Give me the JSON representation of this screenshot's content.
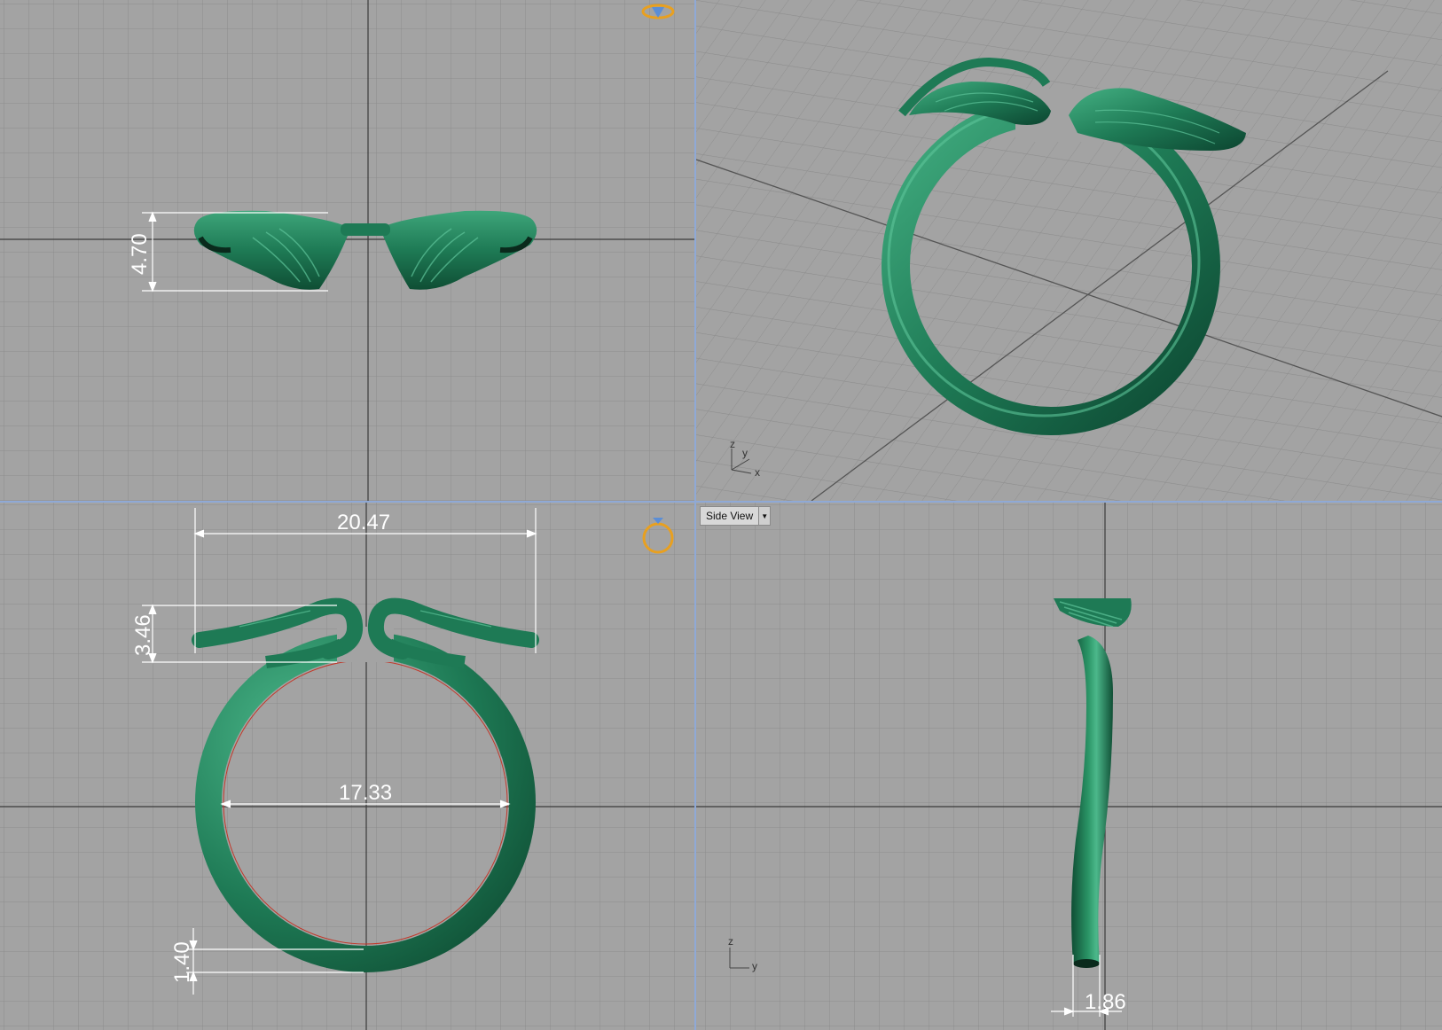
{
  "viewports": {
    "top": {
      "dimensions": {
        "height": "4.70"
      }
    },
    "perspective": {
      "axes": {
        "z": "z",
        "y": "y",
        "x": "x"
      }
    },
    "front": {
      "dimensions": {
        "width_total": "20.47",
        "wing_height": "3.46",
        "inner_diameter": "17.33",
        "band_thickness": "1.40"
      }
    },
    "side": {
      "label": "Side View",
      "dropdown_icon": "chevron-down-icon",
      "axes": {
        "z": "z",
        "y": "y"
      },
      "dimensions": {
        "band_width": "1.86"
      }
    }
  },
  "colors": {
    "ring_green": "#1e7a55",
    "grid_bg": "#a3a3a3",
    "grid_line": "#8c8c8c",
    "axis_line": "#3a3a3a",
    "splitter": "#8fa9d6",
    "gizmo_orange": "#e8a020",
    "gizmo_blue": "#5b8ed6"
  }
}
